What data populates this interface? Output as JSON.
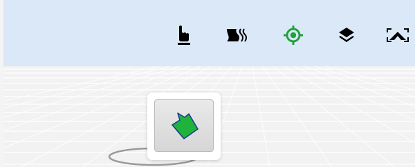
{
  "toolbar": {
    "items": [
      {
        "id": "pointer",
        "icon": "hand-pointer-icon",
        "color": "#000000"
      },
      {
        "id": "terrain",
        "icon": "terrain-icon",
        "color": "#000000"
      },
      {
        "id": "locate",
        "icon": "locate-target-icon",
        "color": "#22a03c",
        "active": true
      },
      {
        "id": "layers",
        "icon": "layers-icon",
        "color": "#000000"
      },
      {
        "id": "landscape",
        "icon": "landscape-view-icon",
        "color": "#000000"
      }
    ]
  },
  "popup": {
    "button": {
      "icon": "polygon-shape-icon",
      "fill": "#1fb33b",
      "stroke": "#1a3f8c"
    }
  },
  "colors": {
    "toolbar_background": "#dbe8f8",
    "viewport_background": "#f2f2f2",
    "accent": "#22a03c"
  }
}
